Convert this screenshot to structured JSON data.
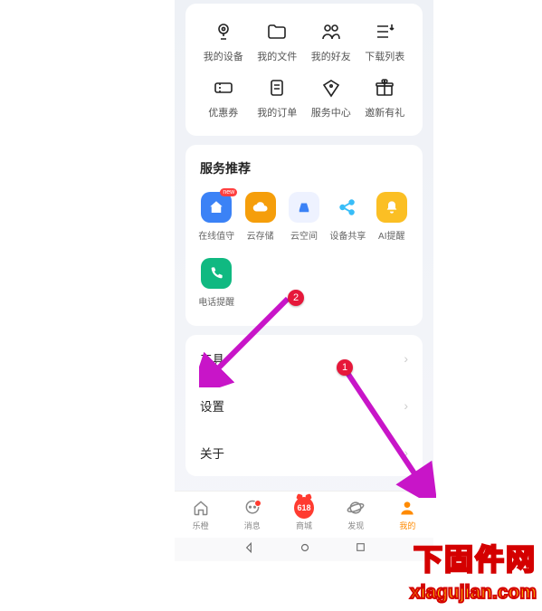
{
  "top_grid": {
    "row1": [
      {
        "name": "my-devices",
        "label": "我的设备",
        "icon": "camera"
      },
      {
        "name": "my-files",
        "label": "我的文件",
        "icon": "folder"
      },
      {
        "name": "my-friends",
        "label": "我的好友",
        "icon": "friends"
      },
      {
        "name": "download-list",
        "label": "下载列表",
        "icon": "download-list"
      }
    ],
    "row2": [
      {
        "name": "coupons",
        "label": "优惠券",
        "icon": "ticket"
      },
      {
        "name": "my-orders",
        "label": "我的订单",
        "icon": "order"
      },
      {
        "name": "service-center",
        "label": "服务中心",
        "icon": "service"
      },
      {
        "name": "invite-gift",
        "label": "邀新有礼",
        "icon": "gift"
      }
    ]
  },
  "services": {
    "title": "服务推荐",
    "items": [
      {
        "name": "online-guard",
        "label": "在线值守",
        "color": "#3b82f6",
        "icon": "home",
        "badge": "new"
      },
      {
        "name": "cloud-storage",
        "label": "云存储",
        "color": "#f59e0b",
        "icon": "cloud"
      },
      {
        "name": "cloud-space",
        "label": "云空间",
        "color": "#3b82f6",
        "icon": "drive"
      },
      {
        "name": "device-share",
        "label": "设备共享",
        "color": "#38bdf8",
        "icon": "share"
      },
      {
        "name": "ai-remind",
        "label": "AI提醒",
        "color": "#fbbf24",
        "icon": "bell"
      },
      {
        "name": "phone-remind",
        "label": "电话提醒",
        "color": "#10b981",
        "icon": "phone"
      }
    ]
  },
  "menu": [
    {
      "name": "tools",
      "label": "工具"
    },
    {
      "name": "settings",
      "label": "设置"
    },
    {
      "name": "about",
      "label": "关于"
    }
  ],
  "tabs": [
    {
      "name": "home",
      "label": "乐橙"
    },
    {
      "name": "messages",
      "label": "消息",
      "dot": true
    },
    {
      "name": "mall",
      "label": "商城",
      "badge618": "618"
    },
    {
      "name": "discover",
      "label": "发现"
    },
    {
      "name": "mine",
      "label": "我的",
      "active": true
    }
  ],
  "annotations": {
    "badge1": "1",
    "badge2": "2"
  },
  "watermark": {
    "line1": "下固件网",
    "line2": "xiagujian.com"
  }
}
